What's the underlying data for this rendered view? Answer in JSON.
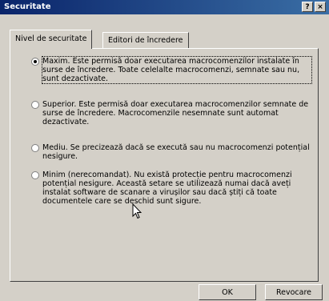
{
  "window": {
    "title": "Securitate",
    "help_label": "?",
    "close_label": "×"
  },
  "tabs": [
    {
      "label": "Nivel de securitate",
      "selected": true
    },
    {
      "label": "Editori de încredere",
      "selected": false
    }
  ],
  "options": [
    {
      "label": "Maxim. Este permisă doar executarea macrocomenzilor instalate în surse de încredere. Toate celelalte macrocomenzi, semnate sau nu, sunt dezactivate.",
      "selected": true
    },
    {
      "label": "Superior. Este permisă doar executarea macrocomenzilor semnate de surse de încredere. Macrocomenzile nesemnate sunt automat dezactivate.",
      "selected": false
    },
    {
      "label": "Mediu. Se precizează dacă se execută sau nu macrocomenzi potențial nesigure.",
      "selected": false
    },
    {
      "label": "Minim (nerecomandat). Nu există protecție pentru macrocomenzi potențial nesigure. Această setare se utilizează numai dacă aveți instalat software de scanare a virușilor sau dacă știți că toate documentele care se deschid sunt sigure.",
      "selected": false
    }
  ],
  "buttons": {
    "ok_label": "OK",
    "cancel_label": "Revocare"
  },
  "colors": {
    "titlebar": "#0a246a",
    "face": "#d4d0c8"
  }
}
